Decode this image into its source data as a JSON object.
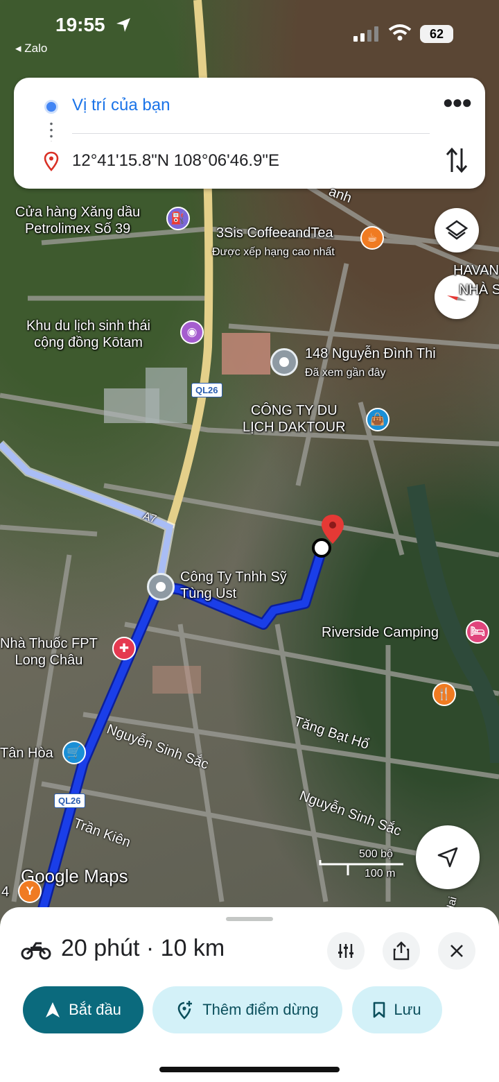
{
  "status_bar": {
    "time": "19:55",
    "back_app": "◂ Zalo",
    "battery": "62"
  },
  "directions": {
    "origin": "Vị trí của bạn",
    "destination": "12°41'15.8\"N 108°06'46.9\"E"
  },
  "map": {
    "labels": {
      "petrolimex_1": "Cửa hàng Xăng dầu",
      "petrolimex_2": "Petrolimex Số 39",
      "coffee": "3Sis CoffeeandTea",
      "coffee_sub": "Được xếp hạng cao nhất",
      "havan_1": "HAVAN",
      "havan_2": "NHÀ S",
      "kotam_1": "Khu du lịch sinh thái",
      "kotam_2": "cộng đồng Kōtam",
      "nguyen_dinh_thi": "148 Nguyễn Đình Thi",
      "nguyen_dinh_thi_sub": "Đã xem gần đây",
      "daktour_1": "CÔNG TY DU",
      "daktour_2": "LỊCH DAKTOUR",
      "tung_ust_1": "Công Ty Tnhh Sỹ",
      "tung_ust_2": "Tùng Ust",
      "riverside": "Riverside Camping",
      "fpt_1": "Nhà Thuốc FPT",
      "fpt_2": "Long Châu",
      "tan_hoa": "Tân Hòa",
      "road_nguyen_sinh_sac_1": "Nguyễn Sinh Sắc",
      "road_nguyen_sinh_sac_2": "Nguyễn Sinh Sắc",
      "road_tang_bat_ho": "Tăng Bạt Hổ",
      "road_tran_kien": "Trần Kiên",
      "road_anh": "anh",
      "road_hai": "Hai",
      "shield_ql26_a": "QL26",
      "shield_ql26_b": "QL26",
      "shield_a7": "A7",
      "scale_ft": "500 bộ",
      "scale_m": "100 m",
      "google_maps": "Google Maps",
      "num_4": "4"
    },
    "route_color": "#1a3ee8",
    "alt_route_color": "#a9bdf5"
  },
  "sheet": {
    "eta": "20 phút · 10 km",
    "start_label": "Bắt đầu",
    "add_stop_label": "Thêm điểm dừng",
    "save_label": "Lưu"
  }
}
